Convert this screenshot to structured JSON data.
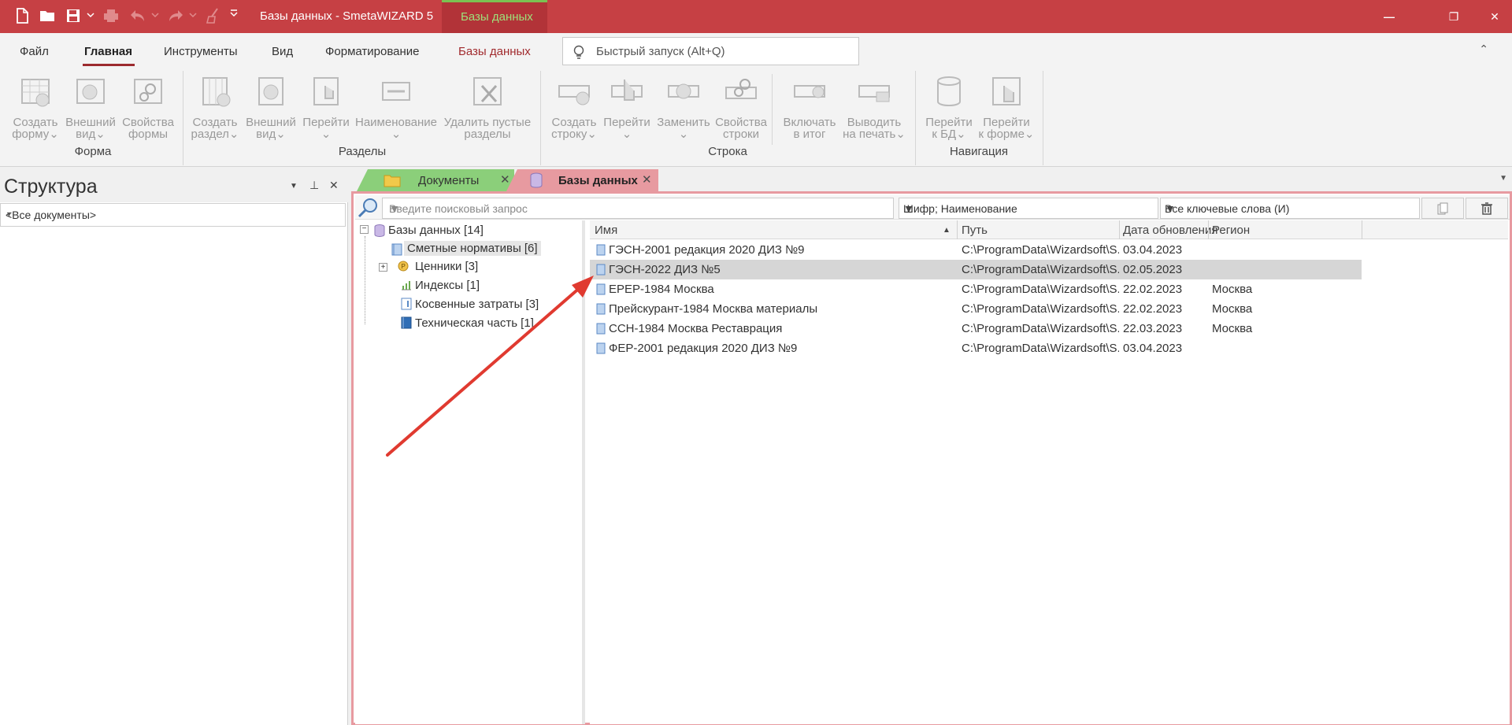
{
  "window": {
    "title": "Базы данных - SmetaWIZARD 5",
    "context_tab": "Базы данных",
    "title_bg": "#c64044",
    "context_accent": "#7cc152"
  },
  "quick_access": [
    "new-file-icon",
    "open-folder-icon",
    "save-icon",
    "print-icon",
    "undo-icon",
    "redo-icon",
    "broom-icon",
    "customize-icon"
  ],
  "ribbon": {
    "tabs": [
      "Файл",
      "Главная",
      "Инструменты",
      "Вид",
      "Форматирование",
      "Базы данных"
    ],
    "active_tab": "Главная",
    "quick_launch_placeholder": "Быстрый запуск (Alt+Q)",
    "groups": {
      "forma": {
        "label": "Форма",
        "buttons": [
          "Создать\nформу⌄",
          "Внешний\nвид⌄",
          "Свойства\nформы"
        ]
      },
      "razdely": {
        "label": "Разделы",
        "buttons": [
          "Создать\nраздел⌄",
          "Внешний\nвид⌄",
          "Перейти\n⌄",
          "Наименование\n⌄",
          "Удалить пустые\nразделы"
        ]
      },
      "stroka": {
        "label": "Строка",
        "buttons": [
          "Создать\nстроку⌄",
          "Перейти\n⌄",
          "Заменить\n⌄",
          "Свойства\nстроки",
          "Включать\nв итог",
          "Выводить\nна печать⌄"
        ]
      },
      "navigatsiya": {
        "label": "Навигация",
        "buttons": [
          "Перейти\nк БД⌄",
          "Перейти\nк форме⌄"
        ]
      }
    }
  },
  "left_panel": {
    "title": "Структура",
    "filter": "<Все документы>"
  },
  "doc_tabs": [
    {
      "label": "Документы",
      "color": "#8bcf7a"
    },
    {
      "label": "Базы данных",
      "color": "#e79aa0"
    }
  ],
  "search": {
    "placeholder": "Введите поисковый запрос",
    "field": "Шифр; Наименование",
    "keywords": "Все ключевые слова (И)"
  },
  "tree": {
    "root": "Базы данных [14]",
    "items": [
      {
        "label": "Сметные нормативы [6]",
        "selected": true,
        "icon": "book-icon"
      },
      {
        "label": "Ценники [3]",
        "selected": false,
        "icon": "price-icon"
      },
      {
        "label": "Индексы [1]",
        "selected": false,
        "icon": "chart-icon"
      },
      {
        "label": "Косвенные затраты [3]",
        "selected": false,
        "icon": "doc-icon"
      },
      {
        "label": "Техническая часть [1]",
        "selected": false,
        "icon": "book-blue-icon"
      }
    ]
  },
  "grid": {
    "columns": [
      "Имя",
      "Путь",
      "Дата обновления",
      "Регион"
    ],
    "rows": [
      {
        "name": "ГЭСН-2001 редакция 2020 ДИЗ №9",
        "path": "C:\\ProgramData\\Wizardsoft\\S...",
        "date": "03.04.2023",
        "region": ""
      },
      {
        "name": "ГЭСН-2022 ДИЗ №5",
        "path": "C:\\ProgramData\\Wizardsoft\\S...",
        "date": "02.05.2023",
        "region": ""
      },
      {
        "name": "ЕРЕР-1984 Москва",
        "path": "C:\\ProgramData\\Wizardsoft\\S...",
        "date": "22.02.2023",
        "region": "Москва"
      },
      {
        "name": "Прейскурант-1984 Москва материалы",
        "path": "C:\\ProgramData\\Wizardsoft\\S...",
        "date": "22.02.2023",
        "region": "Москва"
      },
      {
        "name": "ССН-1984 Москва Реставрация",
        "path": "C:\\ProgramData\\Wizardsoft\\S...",
        "date": "22.03.2023",
        "region": "Москва"
      },
      {
        "name": "ФЕР-2001 редакция 2020 ДИЗ №9",
        "path": "C:\\ProgramData\\Wizardsoft\\S...",
        "date": "03.04.2023",
        "region": ""
      }
    ],
    "selected_row": 1
  }
}
